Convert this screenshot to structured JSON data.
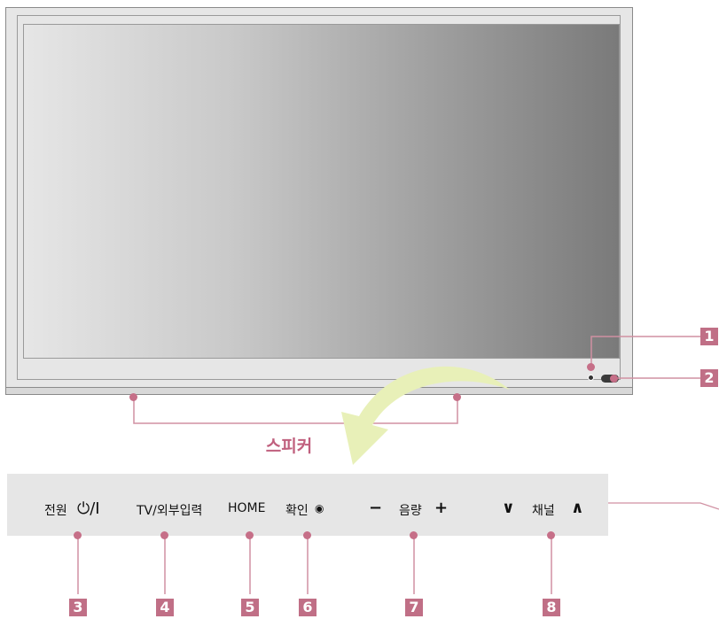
{
  "speaker_label": "스피커",
  "callouts": [
    "1",
    "2",
    "3",
    "4",
    "5",
    "6",
    "7",
    "8"
  ],
  "controls": {
    "power": "전원",
    "power_symbol": "⏻/Ⅰ",
    "input": "TV/외부입력",
    "home": "HOME",
    "ok": "확인",
    "ok_symbol": "◉",
    "volume": "음량",
    "volume_minus": "−",
    "volume_plus": "+",
    "channel": "채널",
    "channel_down": "∨",
    "channel_up": "∧"
  },
  "colors": {
    "accent": "#c06f86",
    "line": "#d090a2",
    "arrow": "#e8f0b8"
  }
}
